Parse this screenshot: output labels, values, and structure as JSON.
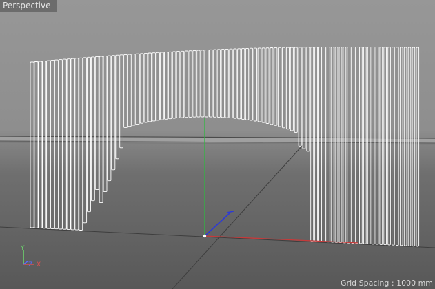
{
  "viewport": {
    "view_name": "Perspective",
    "grid_spacing_text": "Grid Spacing : 1000 mm"
  },
  "axis_gizmo": {
    "y_label": "Y",
    "z_label": "Z",
    "x_label": "X"
  },
  "colors": {
    "x_axis": "#c63a3a",
    "y_axis": "#2fb840",
    "z_axis": "#2d3ad6",
    "gizmo_x": "#e05050",
    "gizmo_y": "#6ee06e",
    "gizmo_z": "#5a6cff",
    "slat_stroke": "#ffffff",
    "slat_fill": "#8a8a8a",
    "horizon": "#4d4d4d"
  },
  "scene_object": {
    "type": "slatted-arch-wall",
    "slat_count": 96
  }
}
